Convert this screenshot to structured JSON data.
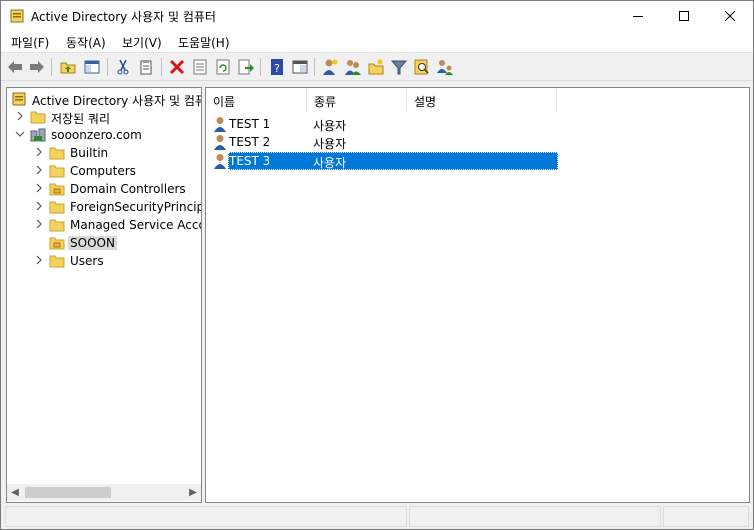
{
  "window": {
    "title": "Active Directory 사용자 및 컴퓨터"
  },
  "menu": [
    {
      "label": "파일(F)"
    },
    {
      "label": "동작(A)"
    },
    {
      "label": "보기(V)"
    },
    {
      "label": "도움말(H)"
    }
  ],
  "toolbar": {
    "buttons": [
      "back-icon",
      "forward-icon",
      "up-folder-icon",
      "show-hide-tree-icon",
      "cut-icon",
      "copy-icon",
      "delete-icon",
      "properties-icon",
      "refresh-icon",
      "export-icon",
      "help-icon",
      "console-icon",
      "new-user-icon",
      "new-group-icon",
      "new-ou-icon",
      "filter-icon",
      "find-icon",
      "delegate-icon"
    ]
  },
  "tree": {
    "root": "Active Directory 사용자 및 컴퓨터",
    "saved_queries": "저장된 쿼리",
    "domain": "sooonzero.com",
    "children": [
      {
        "label": "Builtin"
      },
      {
        "label": "Computers"
      },
      {
        "label": "Domain Controllers"
      },
      {
        "label": "ForeignSecurityPrincipals"
      },
      {
        "label": "Managed Service Accounts"
      },
      {
        "label": "SOOON"
      },
      {
        "label": "Users"
      }
    ]
  },
  "list": {
    "columns": [
      {
        "label": "이름"
      },
      {
        "label": "종류"
      },
      {
        "label": "설명"
      }
    ],
    "rows": [
      {
        "name": "TEST 1",
        "type": "사용자",
        "description": ""
      },
      {
        "name": "TEST 2",
        "type": "사용자",
        "description": ""
      },
      {
        "name": "TEST 3",
        "type": "사용자",
        "description": ""
      }
    ],
    "selected_row": "TEST 3"
  },
  "colors": {
    "selection": "#0078d7",
    "folder": "#f5d25b",
    "user_head": "#c08a56",
    "user_body": "#2a5fa8"
  }
}
